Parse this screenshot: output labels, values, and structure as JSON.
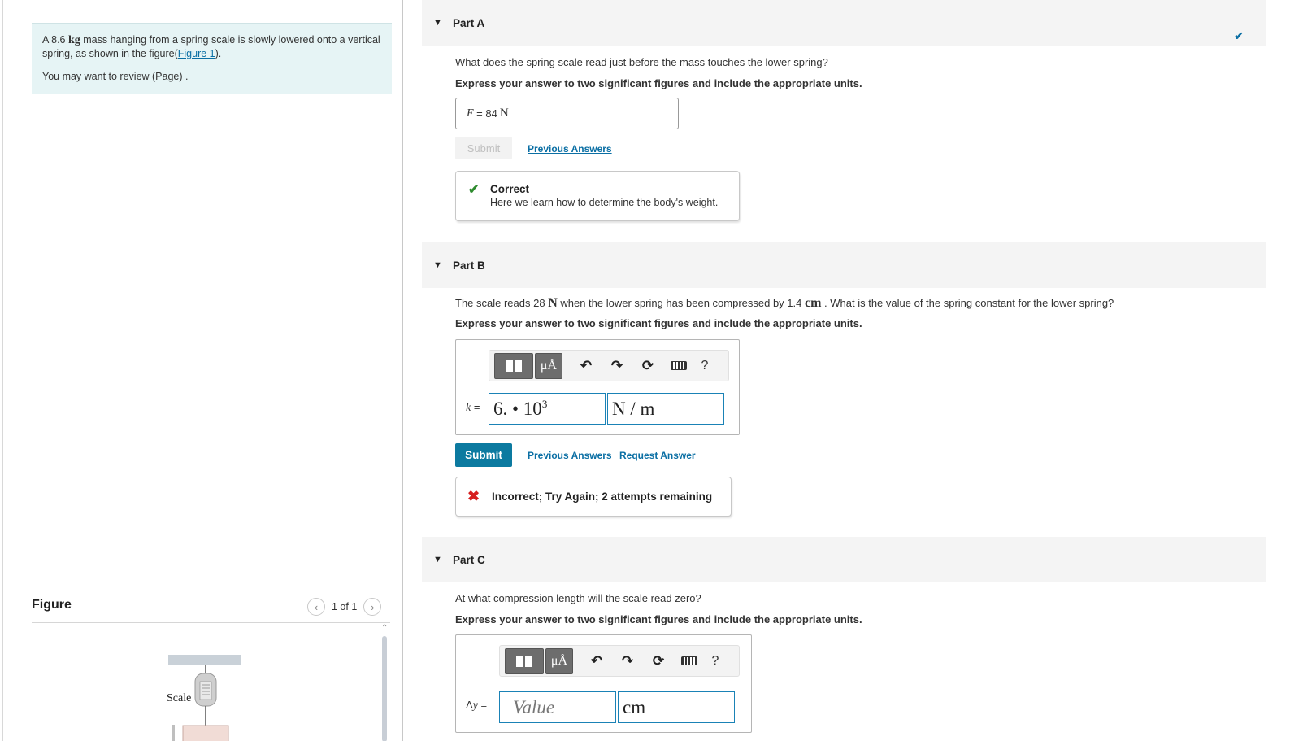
{
  "intro": {
    "text_prefix": "A 8.6 ",
    "mass_unit": "kg",
    "text_middle": " mass hanging from a spring scale is slowly lowered onto a vertical spring, as shown in the figure(",
    "figure_link": "Figure 1",
    "text_suffix": ").",
    "review_text": "You may want to review (Page) ."
  },
  "figure": {
    "title": "Figure",
    "pager": "1 of 1",
    "prev_icon": "chevron-left-icon",
    "next_icon": "chevron-right-icon",
    "scale_label": "Scale"
  },
  "part_a": {
    "title": "Part A",
    "status": "correct",
    "question": "What does the spring scale read just before the mass touches the lower spring?",
    "instruction": "Express your answer to two significant figures and include the appropriate units.",
    "answer_var": "F",
    "answer_eq": " = ",
    "answer_value": "84",
    "answer_unit": "N",
    "submit_label": "Submit",
    "previous_answers": "Previous Answers",
    "feedback_title": "Correct",
    "feedback_text": "Here we learn how to determine the body's weight."
  },
  "part_b": {
    "title": "Part B",
    "question_prefix": "The scale reads 28 ",
    "force_unit": "N",
    "question_middle": " when the lower spring has been compressed by 1.4 ",
    "length_unit": "cm",
    "question_suffix": " . What is the value of the spring constant for the lower spring?",
    "instruction": "Express your answer to two significant figures and include the appropriate units.",
    "answer_var": "k",
    "answer_eq": " = ",
    "value_base": "6. • 10",
    "value_exp": "3",
    "unit_value": "N / m",
    "toolbar": {
      "templates_icon": "templates-icon",
      "units_label": "μÅ",
      "undo_icon": "undo-icon",
      "redo_icon": "redo-icon",
      "reset_icon": "reset-icon",
      "keyboard_icon": "keyboard-icon",
      "help_label": "?"
    },
    "submit_label": "Submit",
    "previous_answers": "Previous Answers",
    "request_answer": "Request Answer",
    "feedback_text": "Incorrect; Try Again; 2 attempts remaining"
  },
  "part_c": {
    "title": "Part C",
    "question": "At what compression length will the scale read zero?",
    "instruction": "Express your answer to two significant figures and include the appropriate units.",
    "answer_prefix": "Δ",
    "answer_var": "y",
    "answer_eq": " = ",
    "value_placeholder": "Value",
    "unit_value": "cm",
    "toolbar": {
      "units_label": "μÅ",
      "help_label": "?"
    }
  },
  "colors": {
    "accent": "#0c7aa0",
    "intro_bg": "#e6f4f5",
    "correct": "#2e8b2e",
    "incorrect": "#d61f1f"
  }
}
